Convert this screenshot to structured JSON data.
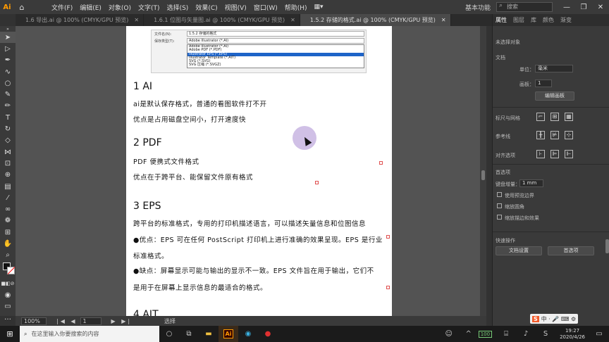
{
  "app": {
    "logo": "Ai"
  },
  "menubar": {
    "items": [
      "文件(F)",
      "编辑(E)",
      "对象(O)",
      "文字(T)",
      "选择(S)",
      "效果(C)",
      "视图(V)",
      "窗口(W)",
      "帮助(H)"
    ],
    "workspace": "基本功能",
    "search_placeholder": "搜索"
  },
  "tabs": [
    {
      "label": "1.6 导出.ai @ 100% (CMYK/GPU 预览)",
      "active": false
    },
    {
      "label": "1.6.1 位图与矢量图.ai @ 100% (CMYK/GPU 预览)",
      "active": false
    },
    {
      "label": "1.5.2 存储的格式.ai @ 100% (CMYK/GPU 预览)",
      "active": true
    }
  ],
  "embedded_dialog": {
    "filename_label": "文件名(N):",
    "filename_value": "1.5.2 存储的格式",
    "type_label": "保存类型(T):",
    "type_value": "Adobe Illustrator (*.AI)",
    "options": [
      {
        "label": "Adobe Illustrator (*.AI)",
        "selected": false
      },
      {
        "label": "Adobe PDF (*.PDF)",
        "selected": false
      },
      {
        "label": "Illustrator EPS (*.EPS)",
        "selected": true
      },
      {
        "label": "Illustrator Template (*.AIT)",
        "selected": false
      },
      {
        "label": "SVG (*.SVG)",
        "selected": false
      },
      {
        "label": "SVG 压缩 (*.SVGZ)",
        "selected": false
      }
    ]
  },
  "document": {
    "sections": [
      {
        "heading": "1 AI",
        "lines": [
          "ai是默认保存格式，普通的看图软件打不开",
          "优点是占用磁盘空间小，打开速度快"
        ]
      },
      {
        "heading": "2 PDF",
        "lines": [
          "PDF 便携式文件格式",
          "优点在于跨平台、能保留文件原有格式"
        ]
      },
      {
        "heading": "3 EPS",
        "lines": [
          "跨平台的标准格式，专用的打印机描述语言，可以描述矢量信息和位图信息",
          "●优点：EPS 可在任何 PostScript 打印机上进行准确的效果呈现。EPS 是行业",
          "标准格式。",
          "●缺点：屏幕显示可能与输出的显示不一致。EPS 文件旨在用于输出，它们不",
          "是用于在屏幕上显示信息的最适合的格式。"
        ]
      },
      {
        "heading": "4 AIT",
        "lines": []
      }
    ]
  },
  "statusbar": {
    "zoom": "100%",
    "page": "1",
    "mode": "选择"
  },
  "panel": {
    "tabs": [
      {
        "label": "属性",
        "active": true
      },
      {
        "label": "图层",
        "active": false
      },
      {
        "label": "库",
        "active": false
      },
      {
        "label": "颜色",
        "active": false
      },
      {
        "label": "渐变",
        "active": false
      }
    ],
    "no_selection": "未选择对象",
    "document_label": "文档",
    "units_label": "单位：",
    "units_value": "毫米",
    "artboard_label": "画板：",
    "artboard_value": "1",
    "edit_artboard_button": "编辑画板",
    "rulers_grid_label": "标尺与网格",
    "guides_label": "参考线",
    "snap_label": "对齐选项",
    "preferences_label": "首选项",
    "keyboard_increment_label": "键盘增量：",
    "keyboard_increment_value": "1 mm",
    "options": [
      "使用预览边界",
      "缩放圆角",
      "缩放描边和效果"
    ],
    "quick_actions_label": "快速操作",
    "doc_setup_button": "文档设置",
    "preferences_button": "首选项"
  },
  "taskbar": {
    "search_placeholder": "在这里输入你要搜索的内容",
    "battery": "100",
    "time": "19:27",
    "date": "2020/4/26"
  },
  "ime": {
    "label": "中 ·"
  }
}
